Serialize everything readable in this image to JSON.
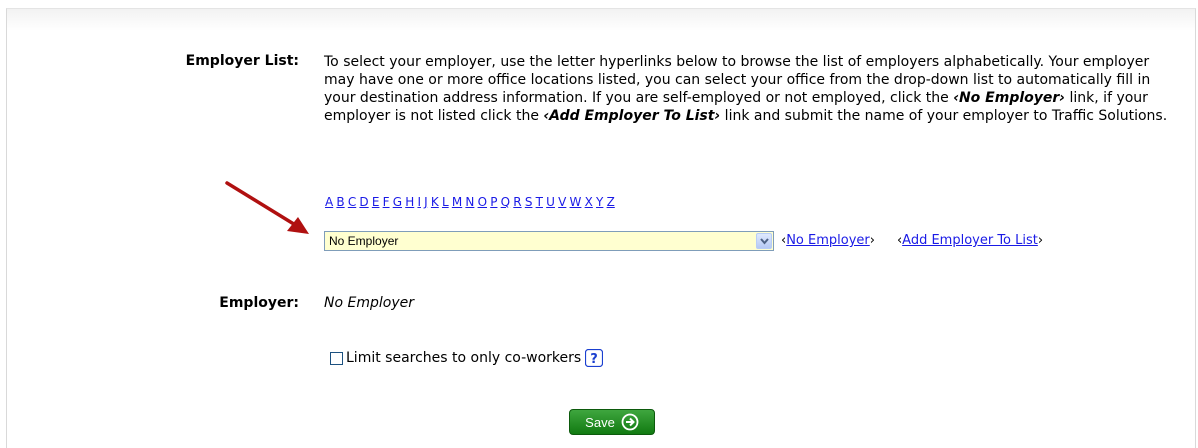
{
  "employer_section": {
    "employer_list_label": "Employer List:",
    "instructions_part1": "To select your employer, use the letter hyperlinks below to browse the list of employers alphabetically. Your employer may have one or more office locations listed, you can select your office from the drop-down list to automatically fill in your destination address information. If you are self-employed or not employed, click the ",
    "instructions_bold1": "‹No Employer›",
    "instructions_part2": " link, if your employer is not listed click the ",
    "instructions_bold2": "‹Add Employer To List›",
    "instructions_part3": " link and submit the name of your employer to Traffic Solutions.",
    "letters": [
      "A",
      "B",
      "C",
      "D",
      "E",
      "F",
      "G",
      "H",
      "I",
      "J",
      "K",
      "L",
      "M",
      "N",
      "O",
      "P",
      "Q",
      "R",
      "S",
      "T",
      "U",
      "V",
      "W",
      "X",
      "Y",
      "Z"
    ],
    "select_value": "No Employer",
    "no_employer_link": "No Employer",
    "add_employer_link": "Add Employer To List",
    "employer_label": "Employer:",
    "employer_value": "No Employer"
  },
  "options": {
    "limit_label": "Limit searches to only co-workers",
    "limit_checked": false
  },
  "actions": {
    "save_label": "Save"
  },
  "colors": {
    "link": "#1a1ae6",
    "select_bg": "#ffffd0",
    "save_button": "#117a11",
    "help_icon": "#1a3fd0",
    "annotation_arrow": "#b01010"
  },
  "icons": {
    "help": "question-mark-icon",
    "save": "circle-arrow-right-icon",
    "dropdown": "chevron-down-icon",
    "annotation": "red-arrow-icon"
  }
}
